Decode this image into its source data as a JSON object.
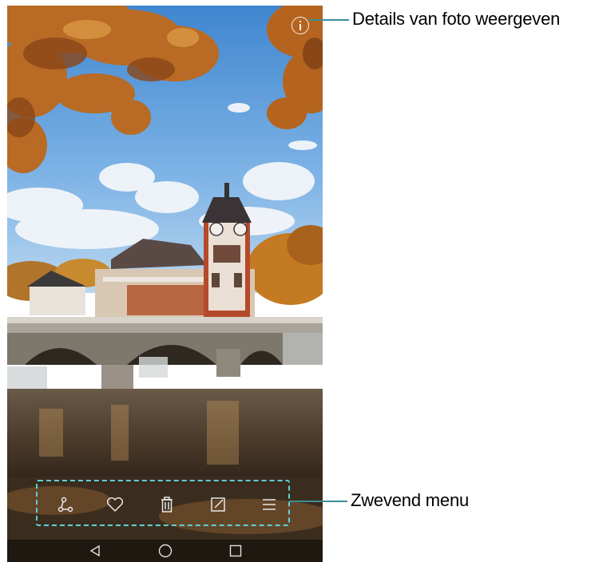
{
  "photo": {
    "icons": {
      "info": "info-icon",
      "share": "share-icon",
      "favorite": "heart-icon",
      "delete": "trash-icon",
      "edit": "edit-icon",
      "more": "menu-icon",
      "back": "back-triangle-icon",
      "home": "home-circle-icon",
      "recents": "recents-square-icon"
    }
  },
  "callouts": {
    "details_label": "Details van foto weergeven",
    "menu_label": "Zwevend menu"
  },
  "colors": {
    "callout_line": "#3a8f96",
    "menu_dash": "#5fd0d8"
  }
}
